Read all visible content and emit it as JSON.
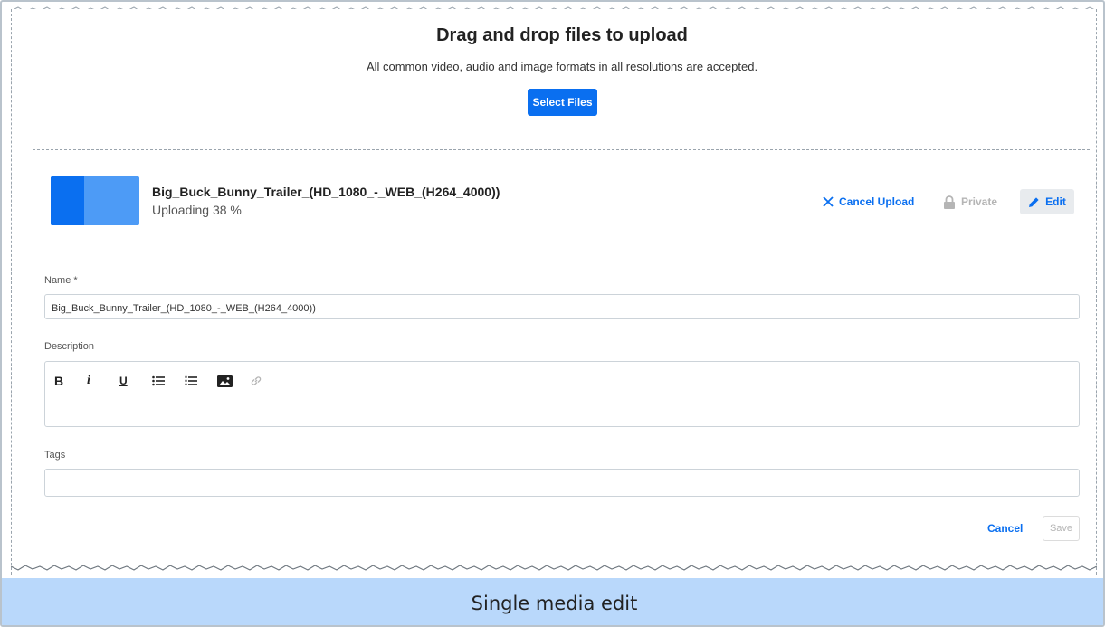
{
  "dropzone": {
    "title": "Drag and drop files to upload",
    "subtitle": "All common video, audio and image formats in all resolutions are accepted.",
    "select_button": "Select Files"
  },
  "upload": {
    "file_name": "Big_Buck_Bunny_Trailer_(HD_1080_-_WEB_(H264_4000))",
    "status": "Uploading 38 %",
    "progress": 0.38,
    "actions": {
      "cancel_upload": "Cancel Upload",
      "private": "Private",
      "edit": "Edit"
    }
  },
  "form": {
    "name_label": "Name *",
    "name_value": "Big_Buck_Bunny_Trailer_(HD_1080_-_WEB_(H264_4000))",
    "description_label": "Description",
    "toolbar": {
      "bold": "B",
      "italic": "i",
      "underline": "U"
    },
    "tags_label": "Tags",
    "cancel_button": "Cancel",
    "save_button": "Save"
  },
  "caption": "Single media edit",
  "colors": {
    "accent": "#0a6ff0",
    "thumb_light": "#4d9bf6",
    "caption_bg": "#b9d8fb",
    "disabled": "#b5b5b5"
  }
}
